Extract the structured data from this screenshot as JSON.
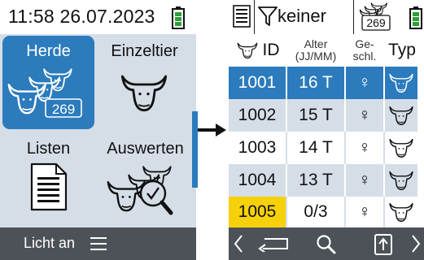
{
  "left_screen": {
    "status": {
      "time_date": "11:58 26.07.2023",
      "battery_icon": "battery-full-icon"
    },
    "menu": [
      {
        "label": "Herde",
        "icon": "herd-icon",
        "badge": "269",
        "selected": true
      },
      {
        "label": "Einzeltier",
        "icon": "cow-head-icon",
        "selected": false
      },
      {
        "label": "Listen",
        "icon": "document-list-icon",
        "selected": false
      },
      {
        "label": "Auswerten",
        "icon": "herd-search-icon",
        "selected": false
      }
    ],
    "footer": {
      "light_label": "Licht an",
      "menu_icon": "hamburger-menu-icon"
    }
  },
  "right_screen": {
    "status": {
      "filter_value": "keiner",
      "herd_count": "269",
      "filter_icon": "funnel-icon"
    },
    "table": {
      "columns": [
        {
          "key": "id",
          "label": "ID"
        },
        {
          "key": "age",
          "label": "Alter\n(JJ/MM)"
        },
        {
          "key": "sex",
          "label": "Ge-\nschl."
        },
        {
          "key": "type",
          "label": "Typ"
        }
      ],
      "rows": [
        {
          "id": "1001",
          "age": "16 T",
          "sex": "♀",
          "type_icon": "cow-head-icon",
          "selected": true
        },
        {
          "id": "1002",
          "age": "15 T",
          "sex": "♀",
          "type_icon": "cow-head-icon"
        },
        {
          "id": "1003",
          "age": "14 T",
          "sex": "♀",
          "type_icon": "cow-head-icon"
        },
        {
          "id": "1004",
          "age": "13 T",
          "sex": "♀",
          "type_icon": "cow-head-icon"
        },
        {
          "id": "1005",
          "age": "0/3",
          "sex": "♀",
          "type_icon": "cow-head-icon",
          "highlight": "new"
        }
      ]
    },
    "footer": {
      "icons": [
        "chevron-left-icon",
        "back-icon",
        "search-icon",
        "export-icon",
        "chevron-right-icon"
      ]
    }
  },
  "colors": {
    "accent_blue": "#2b7bbd",
    "row_alt": "#d5dee7",
    "footer_dark": "#4d5258",
    "battery_green": "#2e9e3a",
    "new_id_yellow": "#f6d10a"
  }
}
